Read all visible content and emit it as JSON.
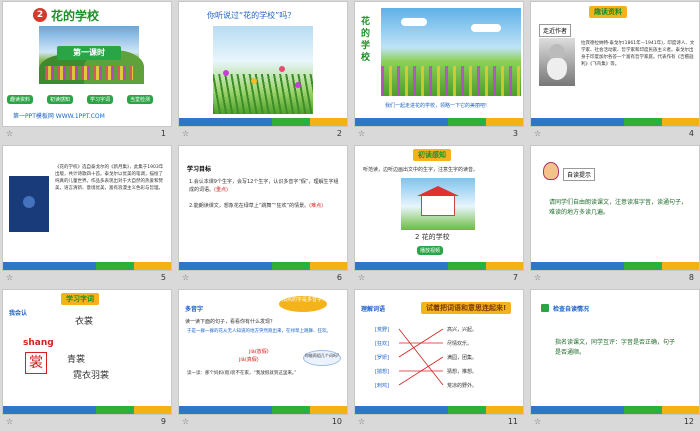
{
  "slides": [
    {
      "num": "1",
      "lesson_badge": "2",
      "title": "花的学校",
      "lesson_label": "第一课时",
      "buttons": [
        "趣读资料",
        "初读感知",
        "学习字词",
        "当堂检测"
      ],
      "footer_text": "第一PPT模板网 WWW.1PPT.COM"
    },
    {
      "num": "2",
      "question": "你听说过“花的学校”吗？"
    },
    {
      "num": "3",
      "side_title": "花的学校",
      "caption": "我们一起走进花的学校，领略一下它的美丽吧!"
    },
    {
      "num": "4",
      "header": "趣读资料",
      "tag": "走近作者",
      "bio": "拉宾德拉纳特·泰戈尔(1861年—1941年)，印度诗人、文学家、社会活动家、哲学家和印度民族主义者。泰戈尔出身于印度加尔各答一个富有哲学家庭。代表作有《吉檀迦利》《飞鸟集》等。"
    },
    {
      "num": "5",
      "text": "《花的学校》选自泰戈尔的《新月集》，此集于1903年出版，共计诗歌四十首。泰戈尔以优美的笔调，描绘了纯真的儿童世界。作品多表现出对于大自然的热爱和赞美，语言清新、意境优美，富有浪漫主义色彩与哲理。"
    },
    {
      "num": "6",
      "heading": "学习目标",
      "goal1": "1.会认本课9个生字，会写12个生字，认识多音字“假”，理解生字组成的词语。",
      "goal1_mark": "(重点)",
      "goal2": "2.能朗读课文，想象花在绿草上“跳舞”“狂欢”的情景。",
      "goal2_mark": "(难点)"
    },
    {
      "num": "7",
      "header": "初读感知",
      "instruction": "听范读，边听边画出文中的生字，注意生字的读音。",
      "picture_caption": "2 花的学校",
      "button": "播放视频"
    },
    {
      "num": "8",
      "tag": "自读提示",
      "tip": "请同学们自由朗读课文，注意读准字音，读通句子，难读的地方多读几遍。"
    },
    {
      "num": "9",
      "header": "学习字词",
      "tag": "我会认",
      "word_top": "衣裳",
      "pinyin": "shang",
      "char": "裳",
      "word1": "青裳",
      "word2": "霓衣羽裳"
    },
    {
      "num": "10",
      "tag": "多音字",
      "bubble": "加点的字是多音字!",
      "prompt": "读一读下面的句子，看看你有什么发现？",
      "sentence1": "于是一群一群的花从无人知道的地方突然跑出来，在绿草上跳舞、狂欢。",
      "reading1": "jià(放假)",
      "reading2": "jiǎ(真假)",
      "sentence2": "读一读：那个妈妈(假)装不在家，“我放假就到这里来。”",
      "cloud": "你能再组几个词吗?"
    },
    {
      "num": "11",
      "tag": "理解词语",
      "banner": "试着把词语和意思连起来!",
      "left_words": [
        "[荒野]",
        "[狂欢]",
        "[罗妍]",
        "[揣想]",
        "[刺鸡]"
      ],
      "right_words": [
        "高兴，兴起。",
        "尽情欢乐。",
        "满园，团集。",
        "猜想，推想。",
        "荒凉的野外。"
      ]
    },
    {
      "num": "12",
      "tag": "检查自读情况",
      "text": "指名读课文，同学互评：字音是否正确，句子是否通顺。"
    }
  ]
}
